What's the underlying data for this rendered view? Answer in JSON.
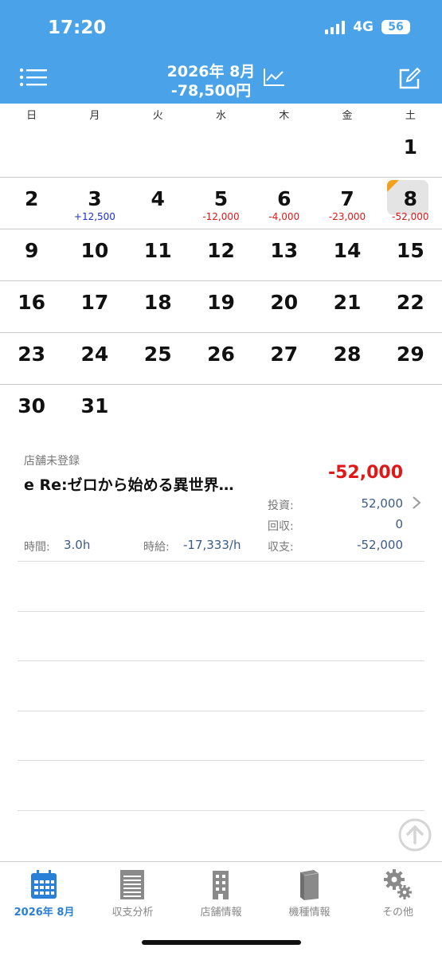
{
  "status": {
    "time": "17:20",
    "network": "4G",
    "battery": "56"
  },
  "header": {
    "month": "2026年 8月",
    "total": "-78,500円"
  },
  "weekdays": [
    "日",
    "月",
    "火",
    "水",
    "木",
    "金",
    "土"
  ],
  "calendar": {
    "days": {
      "d1": "1",
      "d2": "2",
      "d3": "3",
      "d4": "4",
      "d5": "5",
      "d6": "6",
      "d7": "7",
      "d8": "8",
      "d9": "9",
      "d10": "10",
      "d11": "11",
      "d12": "12",
      "d13": "13",
      "d14": "14",
      "d15": "15",
      "d16": "16",
      "d17": "17",
      "d18": "18",
      "d19": "19",
      "d20": "20",
      "d21": "21",
      "d22": "22",
      "d23": "23",
      "d24": "24",
      "d25": "25",
      "d26": "26",
      "d27": "27",
      "d28": "28",
      "d29": "29",
      "d30": "30",
      "d31": "31"
    },
    "amounts": {
      "d3": "+12,500",
      "d5": "-12,000",
      "d6": "-4,000",
      "d7": "-23,000",
      "d8": "-52,000"
    }
  },
  "entry": {
    "store": "店舗未登録",
    "machine": "e Re:ゼロから始める異世界…",
    "result": "-52,000",
    "invest_label": "投資:",
    "invest_value": "52,000",
    "return_label": "回収:",
    "return_value": "0",
    "balance_label": "収支:",
    "balance_value": "-52,000",
    "time_label": "時間:",
    "time_value": "3.0h",
    "hourly_label": "時給:",
    "hourly_value": "-17,333/h"
  },
  "tabs": [
    {
      "label": "2026年 8月"
    },
    {
      "label": "収支分析"
    },
    {
      "label": "店舗情報"
    },
    {
      "label": "機種情報"
    },
    {
      "label": "その他"
    }
  ],
  "colors": {
    "accent": "#4aa3e8",
    "negative": "#e01818",
    "positive": "#1a2fd0",
    "marker": "#f4a01c"
  }
}
